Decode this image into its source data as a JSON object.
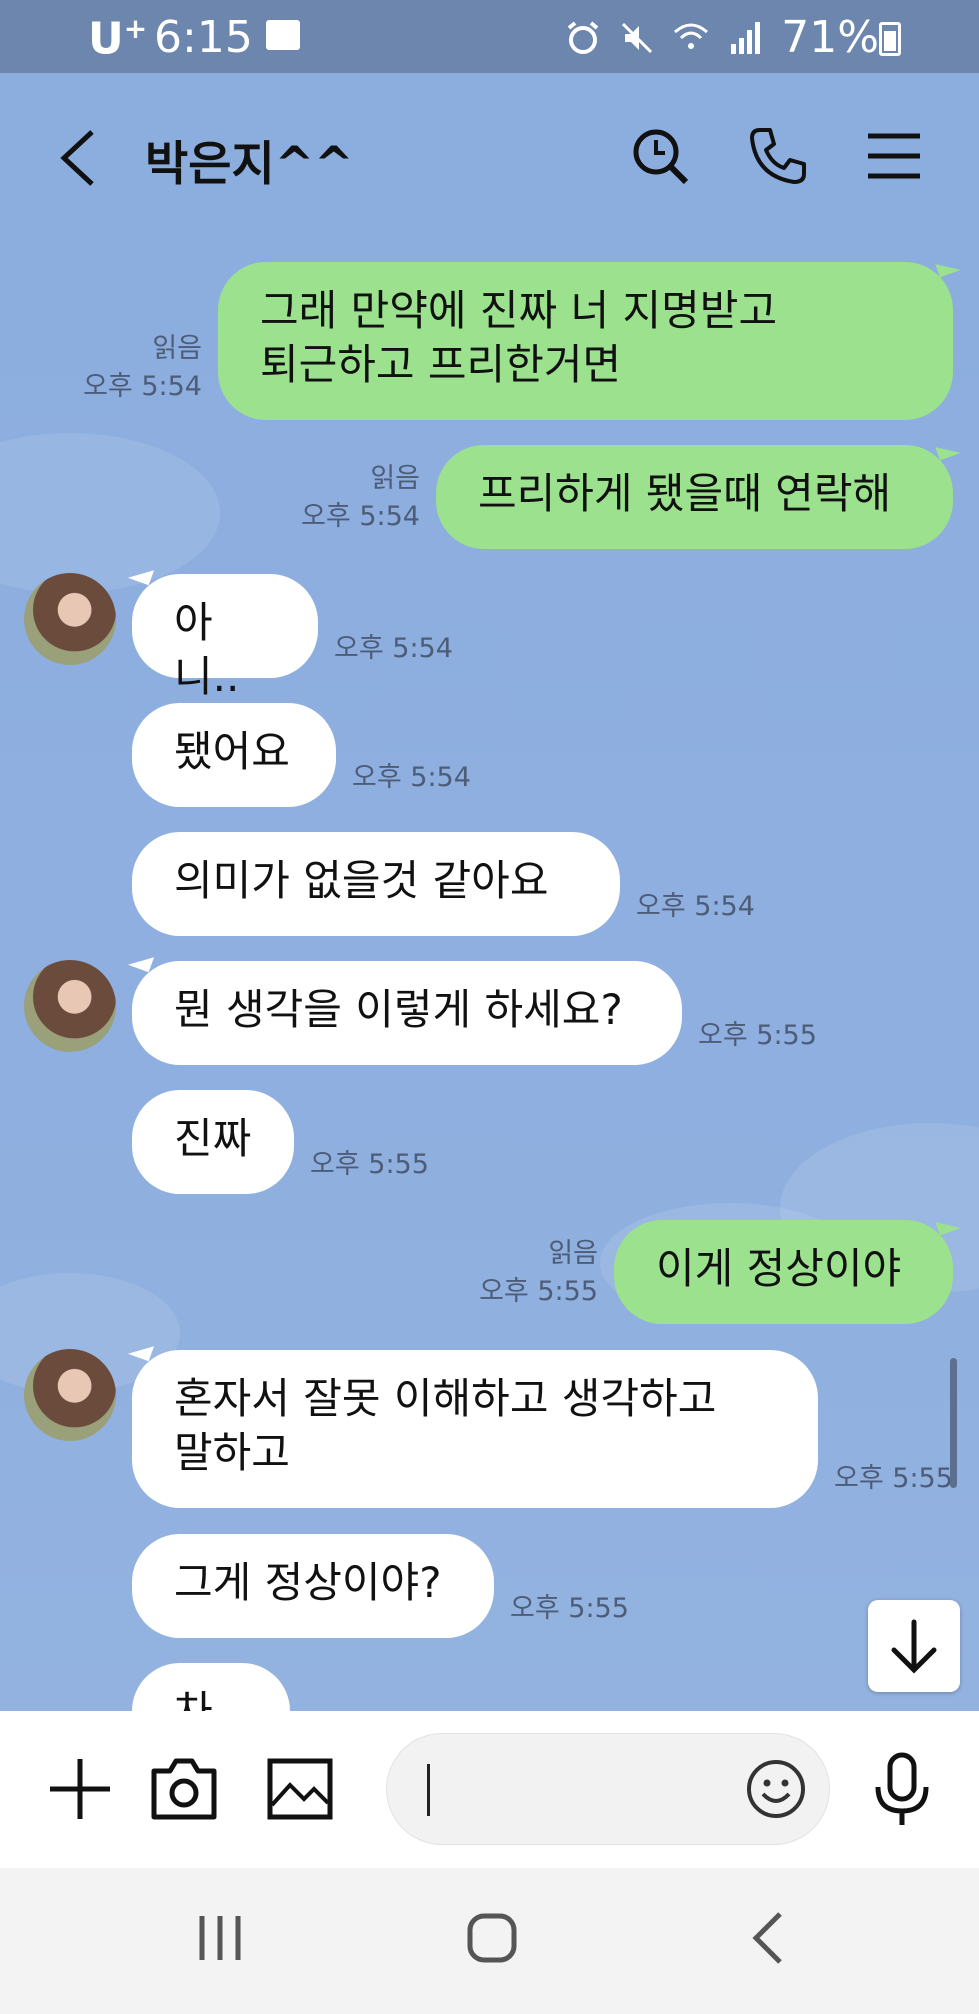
{
  "status_bar": {
    "carrier": "U",
    "carrier_sup": "+",
    "time": "6:15",
    "battery": "71%"
  },
  "header": {
    "title": "박은지^^"
  },
  "messages": [
    {
      "from": "me",
      "lines": [
        "그래 만약에 진짜 너 지명받고",
        "퇴근하고 프리한거면"
      ],
      "read": "읽음",
      "time": "오후 5:54"
    },
    {
      "from": "me",
      "lines": [
        "프리하게 됐을때 연락해"
      ],
      "read": "읽음",
      "time": "오후 5:54"
    },
    {
      "from": "them",
      "lines": [
        "아니.."
      ],
      "time": "오후 5:54"
    },
    {
      "from": "them",
      "lines": [
        "됐어요"
      ],
      "time": "오후 5:54"
    },
    {
      "from": "them",
      "lines": [
        "의미가 없을것 같아요"
      ],
      "time": "오후 5:54"
    },
    {
      "from": "them",
      "lines": [
        "뭔 생각을 이렇게 하세요?"
      ],
      "time": "오후 5:55"
    },
    {
      "from": "them",
      "lines": [
        "진짜"
      ],
      "time": "오후 5:55"
    },
    {
      "from": "me",
      "lines": [
        "이게 정상이야"
      ],
      "read": "읽음",
      "time": "오후 5:55"
    },
    {
      "from": "them",
      "lines": [
        "혼자서 잘못 이해하고 생각하고",
        "말하고"
      ],
      "time": "오후 5:55"
    },
    {
      "from": "them",
      "lines": [
        "그게 정상이야?"
      ],
      "time": "오후 5:55"
    },
    {
      "from": "them",
      "lines": [
        "차"
      ],
      "time": ""
    }
  ],
  "icons": {
    "back": "chevron-left-icon",
    "search": "search-icon",
    "call": "phone-icon",
    "menu": "menu-icon",
    "add": "plus-icon",
    "camera": "camera-icon",
    "gallery": "image-icon",
    "emoji": "emoji-icon",
    "mic": "microphone-icon",
    "scroll_down": "arrow-down-icon"
  },
  "colors": {
    "chat_background": "#8eaedd",
    "outgoing_bubble": "#9be18e",
    "incoming_bubble": "#ffffff",
    "status_bar": "#6d86ad"
  }
}
